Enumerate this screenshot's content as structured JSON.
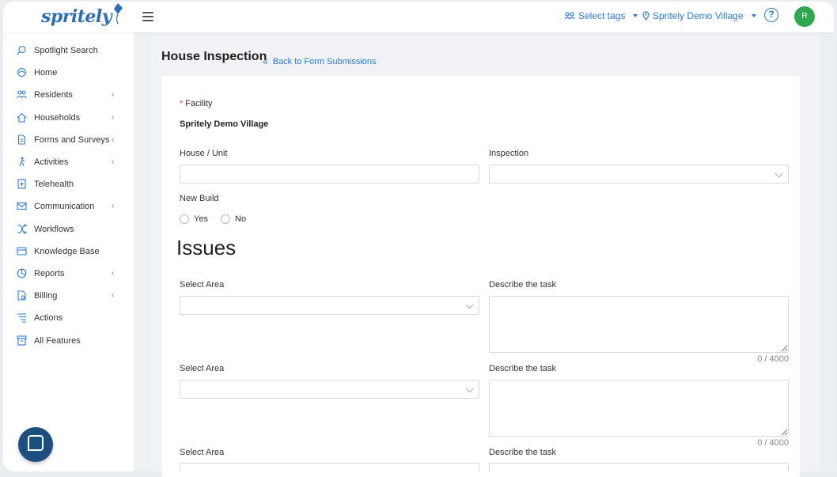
{
  "header": {
    "logo_text": "spritely",
    "select_tags": "Select tags",
    "location": "Spritely Demo Village",
    "help_symbol": "?",
    "avatar_initial": "R"
  },
  "sidebar": {
    "items": [
      {
        "label": "Spotlight Search",
        "icon": "search-icon",
        "has_children": false
      },
      {
        "label": "Home",
        "icon": "home-icon",
        "has_children": false
      },
      {
        "label": "Residents",
        "icon": "residents-icon",
        "has_children": true
      },
      {
        "label": "Households",
        "icon": "house-icon",
        "has_children": true
      },
      {
        "label": "Forms and Surveys",
        "icon": "document-icon",
        "has_children": true
      },
      {
        "label": "Activities",
        "icon": "activity-icon",
        "has_children": true
      },
      {
        "label": "Telehealth",
        "icon": "telehealth-icon",
        "has_children": false
      },
      {
        "label": "Communication",
        "icon": "mail-icon",
        "has_children": true
      },
      {
        "label": "Workflows",
        "icon": "workflow-icon",
        "has_children": false
      },
      {
        "label": "Knowledge Base",
        "icon": "book-icon",
        "has_children": false
      },
      {
        "label": "Reports",
        "icon": "chart-icon",
        "has_children": true
      },
      {
        "label": "Billing",
        "icon": "billing-icon",
        "has_children": true
      },
      {
        "label": "Actions",
        "icon": "list-icon",
        "has_children": false
      },
      {
        "label": "All Features",
        "icon": "archive-icon",
        "has_children": false
      }
    ]
  },
  "page": {
    "title": "House Inspection",
    "back_link": "Back to Form Submissions"
  },
  "form": {
    "facility_label": "Facility",
    "facility_required": "*",
    "facility_value": "Spritely Demo Village",
    "house_unit_label": "House / Unit",
    "house_unit_value": "",
    "inspection_label": "Inspection",
    "new_build_label": "New Build",
    "new_build_options": [
      "Yes",
      "No"
    ],
    "issues_heading": "Issues",
    "issues": [
      {
        "area_label": "Select Area",
        "task_label": "Describe the task",
        "counter": "0 / 4000"
      },
      {
        "area_label": "Select Area",
        "task_label": "Describe the task",
        "counter": "0 / 4000"
      },
      {
        "area_label": "Select Area",
        "task_label": "Describe the task",
        "counter": ""
      }
    ]
  },
  "colors": {
    "accent": "#2e7bd6",
    "avatar": "#2ea84f",
    "chat": "#1d4e80"
  }
}
